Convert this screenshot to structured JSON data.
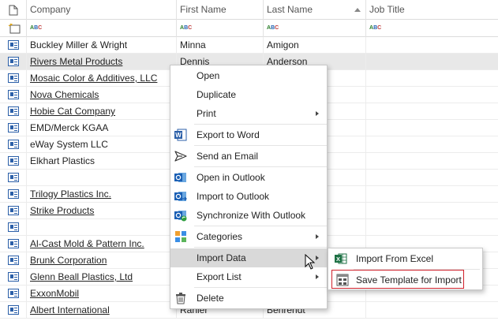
{
  "columns": {
    "company": "Company",
    "first_name": "First Name",
    "last_name": "Last Name",
    "job_title": "Job Title"
  },
  "filter_text": "ABC",
  "rows": [
    {
      "company": "Buckley Miller & Wright",
      "first": "Minna",
      "last": "Amigon",
      "link": false
    },
    {
      "company": "Rivers Metal Products",
      "first": "Dennis",
      "last": "Anderson",
      "link": true
    },
    {
      "company": "Mosaic Color & Additives, LLC",
      "first": "",
      "last": "",
      "link": true
    },
    {
      "company": "Nova Chemicals",
      "first": "",
      "last": "",
      "link": true
    },
    {
      "company": "Hobie Cat Company",
      "first": "",
      "last": "",
      "link": true
    },
    {
      "company": "EMD/Merck KGAA",
      "first": "",
      "last": "",
      "link": false
    },
    {
      "company": "eWay System LLC",
      "first": "",
      "last": "",
      "link": false
    },
    {
      "company": "Elkhart Plastics",
      "first": "",
      "last": "",
      "link": false
    },
    {
      "company": "",
      "first": "",
      "last": "",
      "link": false
    },
    {
      "company": "Trilogy Plastics Inc.",
      "first": "",
      "last": "",
      "link": true
    },
    {
      "company": "Strike Products",
      "first": "",
      "last": "",
      "link": true
    },
    {
      "company": "",
      "first": "",
      "last": "",
      "link": false
    },
    {
      "company": "Al-Cast Mold & Pattern Inc.",
      "first": "",
      "last": "",
      "link": true
    },
    {
      "company": "Brunk Corporation",
      "first": "",
      "last": "",
      "link": true
    },
    {
      "company": "Glenn Beall Plastics, Ltd",
      "first": "",
      "last": "",
      "link": true
    },
    {
      "company": "ExxonMobil",
      "first": "",
      "last": "",
      "link": true
    },
    {
      "company": "Albert International",
      "first": "Ranier",
      "last": "Behrendt",
      "link": true
    }
  ],
  "context_menu": {
    "open": "Open",
    "duplicate": "Duplicate",
    "print": "Print",
    "export_word": "Export to Word",
    "send_email": "Send an Email",
    "open_outlook": "Open in Outlook",
    "import_outlook": "Import to Outlook",
    "sync_outlook": "Synchronize With Outlook",
    "categories": "Categories",
    "import_data": "Import Data",
    "export_list": "Export List",
    "delete": "Delete"
  },
  "submenu": {
    "import_excel": "Import From Excel",
    "save_template": "Save Template for Import"
  },
  "colors": {
    "highlight_outline": "#d0202a",
    "selected_row": "#e8e8e8",
    "menu_highlight": "#d9d9d9",
    "icon_blue": "#2b5fa8"
  }
}
